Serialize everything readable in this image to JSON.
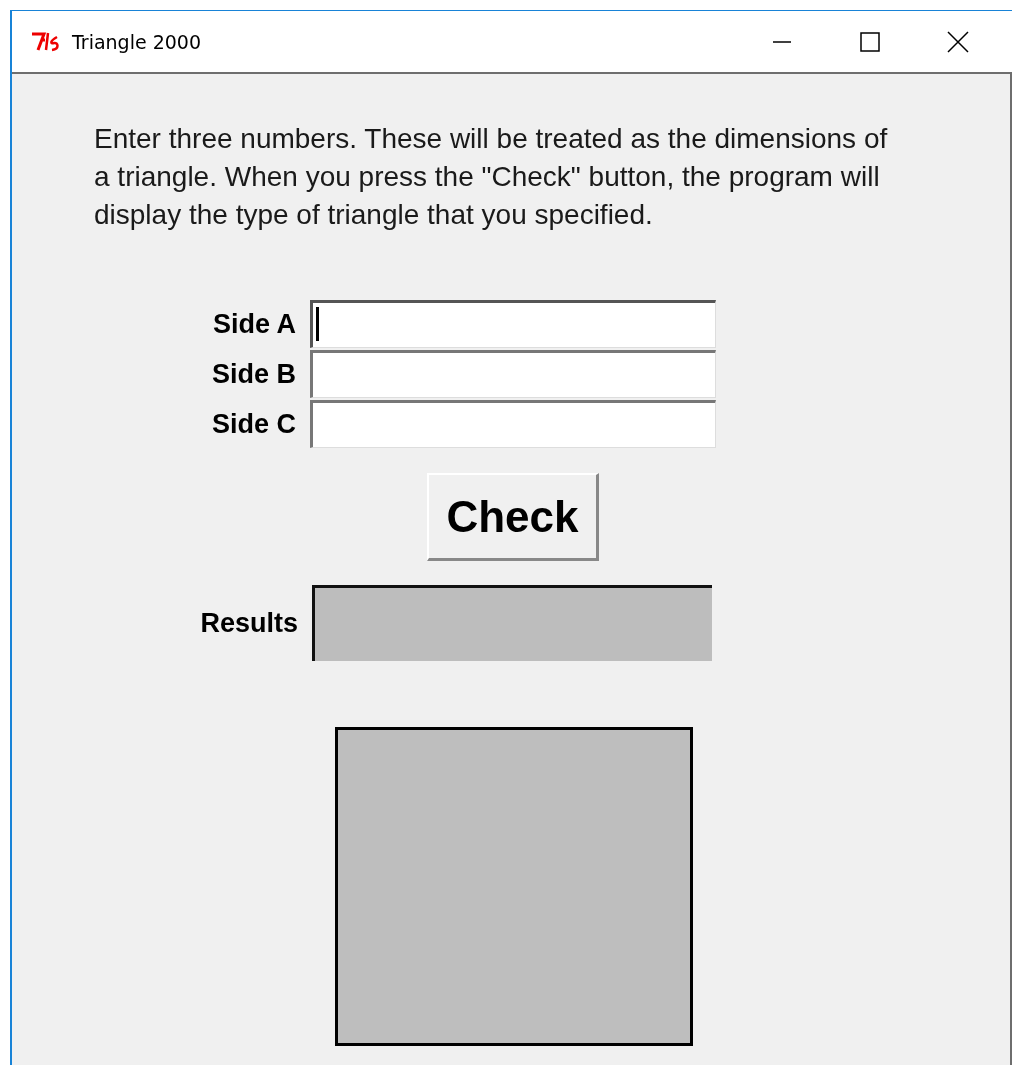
{
  "window": {
    "title": "Triangle 2000"
  },
  "instructions": "Enter three numbers. These will be treated as the dimensions of a triangle. When you press the \"Check\" button, the program will display the type of triangle that you specified.",
  "fields": [
    {
      "label": "Side A",
      "focused": true
    },
    {
      "label": "Side B",
      "focused": false
    },
    {
      "label": "Side C",
      "focused": false
    }
  ],
  "check_button": {
    "label": "Check"
  },
  "results": {
    "label": "Results"
  }
}
